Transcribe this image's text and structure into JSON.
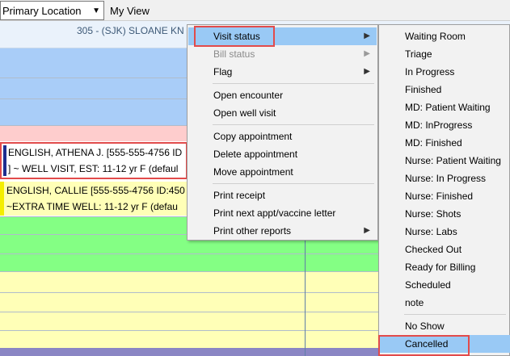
{
  "toolbar": {
    "location_value": "Primary Location",
    "view_label": "My View"
  },
  "schedule": {
    "provider_header": "305  - (SJK) SLOANE KN",
    "appointments": [
      {
        "line1": "ENGLISH, ATHENA J.  [555-555-4756 ID",
        "line2": "] ~ WELL VISIT, EST: 11-12 yr F (defaul"
      },
      {
        "line1": "ENGLISH, CALLIE [555-555-4756 ID:450",
        "line2": "~EXTRA TIME WELL: 11-12 yr F (defau"
      }
    ]
  },
  "context_menu": {
    "items": [
      {
        "label": "Visit status",
        "submenu": true,
        "highlighted": true
      },
      {
        "label": "Bill status",
        "submenu": true,
        "disabled": true
      },
      {
        "label": "Flag",
        "submenu": true
      },
      {
        "label": "Open encounter"
      },
      {
        "label": "Open well visit"
      },
      {
        "label": "Copy appointment"
      },
      {
        "label": "Delete appointment"
      },
      {
        "label": "Move appointment"
      },
      {
        "label": "Print receipt"
      },
      {
        "label": "Print next appt/vaccine letter"
      },
      {
        "label": "Print other reports",
        "submenu": true
      }
    ]
  },
  "visit_status_menu": {
    "items": [
      "Waiting Room",
      "Triage",
      "In Progress",
      "Finished",
      "MD: Patient Waiting",
      "MD: InProgress",
      "MD: Finished",
      "Nurse: Patient Waiting",
      "Nurse: In Progress",
      "Nurse: Finished",
      "Nurse: Shots",
      "Nurse: Labs",
      "Checked Out",
      "Ready for Billing",
      "Scheduled",
      "note",
      "No Show",
      "Cancelled"
    ],
    "highlighted": "Cancelled"
  },
  "colors": {
    "slot_blue": "#a9cdf8",
    "slot_pink": "#fecdcd",
    "slot_green": "#84ff84",
    "slot_yellow": "#ffffb7",
    "slot_purple": "#8a86c4",
    "menu_highlight": "#99c9f5",
    "callout_red": "#e24b4b"
  }
}
